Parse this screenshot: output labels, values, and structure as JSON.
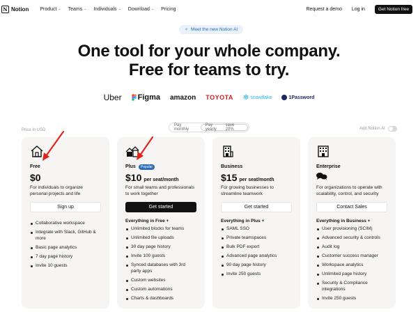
{
  "nav": {
    "brand": "Notion",
    "links": [
      {
        "label": "Product",
        "has_menu": true
      },
      {
        "label": "Teams",
        "has_menu": true
      },
      {
        "label": "Individuals",
        "has_menu": true
      },
      {
        "label": "Download",
        "has_menu": true
      },
      {
        "label": "Pricing",
        "has_menu": false
      }
    ],
    "request_demo": "Request a demo",
    "login": "Log in",
    "get_free": "Get Notion free"
  },
  "hero": {
    "pill": "Meet the new Notion AI",
    "title_line1": "One tool for your whole company.",
    "title_line2": "Free for teams to try."
  },
  "logos": [
    "Uber",
    "Figma",
    "amazon",
    "TOYOTA",
    "snowflake",
    "1Password"
  ],
  "pricing": {
    "price_in": "Price in USD",
    "toggle": {
      "monthly": "Pay monthly",
      "yearly": "Pay yearly",
      "save": "save 20%",
      "selected": "yearly"
    },
    "add_ai": "Add Notion AI",
    "add_ai_on": false
  },
  "plans": [
    {
      "name": "Free",
      "badge": "",
      "price": "$0",
      "price_suffix": "",
      "description": "For individuals to organize personal projects and life",
      "cta": "Sign up",
      "cta_dark": false,
      "everything": "",
      "features": [
        "Collaborative workspace",
        "Integrate with Slack, GitHub & more",
        "Basic page analytics",
        "7 day page history",
        "Invite 10 guests"
      ]
    },
    {
      "name": "Plus",
      "badge": "Popular",
      "price": "$10",
      "price_suffix": "per seat/month",
      "description": "For small teams and professionals to work together",
      "cta": "Get started",
      "cta_dark": true,
      "everything": "Everything in Free +",
      "features": [
        "Unlimited blocks for teams",
        "Unlimited file uploads",
        "30 day page history",
        "Invite 100 guests",
        "Synced databases with 3rd party apps",
        "Custom websites",
        "Custom automations",
        "Charts & dashboards"
      ]
    },
    {
      "name": "Business",
      "badge": "",
      "price": "$15",
      "price_suffix": "per seat/month",
      "description": "For growing businesses to streamline teamwork",
      "cta": "Get started",
      "cta_dark": false,
      "everything": "Everything in Plus +",
      "features": [
        "SAML SSO",
        "Private teamspaces",
        "Bulk PDF export",
        "Advanced page analytics",
        "90 day page history",
        "Invite 250 guests"
      ]
    },
    {
      "name": "Enterprise",
      "badge": "",
      "price": "",
      "price_suffix": "",
      "description": "For organizations to operate with scalability, control, and security",
      "cta": "Contact Sales",
      "cta_dark": false,
      "everything": "Everything in Business +",
      "features": [
        "User provisioning (SCIM)",
        "Advanced security & controls",
        "Audit log",
        "Customer success manager",
        "Workspace analytics",
        "Unlimited page history",
        "Security & Compliance integrations",
        "Invite 250 guests"
      ]
    }
  ],
  "colors": {
    "accent": "#2c6cb5",
    "card_bg": "#f6f5f4",
    "arrow": "#e0241b"
  }
}
